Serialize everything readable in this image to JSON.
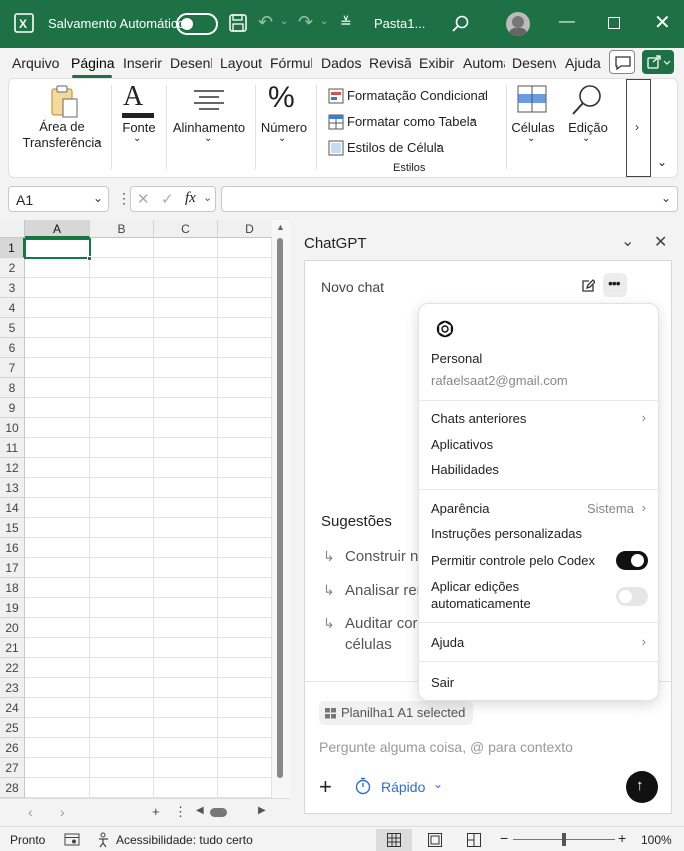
{
  "titlebar": {
    "autosave_label": "Salvamento Automático",
    "doc_name": "Pasta1..."
  },
  "menu_tabs": [
    "Arquivo",
    "Página",
    "Inserir",
    "Desenh",
    "Layout",
    "Fórmul",
    "Dados",
    "Revisã",
    "Exibir",
    "Automa",
    "Desenv",
    "Ajuda"
  ],
  "ribbon": {
    "clipboard": "Área de\nTransferência",
    "font": "Fonte",
    "alignment": "Alinhamento",
    "number": "Número",
    "cond_format": "Formatação Condicional",
    "format_table": "Formatar como Tabela",
    "cell_styles": "Estilos de Célula",
    "styles_group": "Estilos",
    "cells": "Células",
    "editing": "Edição",
    "clipboard_l1": "Área de",
    "clipboard_l2": "Transferência"
  },
  "formula": {
    "name_box": "A1",
    "fx": "fx"
  },
  "grid": {
    "columns": [
      "A",
      "B",
      "C",
      "D"
    ],
    "rows": [
      "1",
      "2",
      "3",
      "4",
      "5",
      "6",
      "7",
      "8",
      "9",
      "10",
      "11",
      "12",
      "13",
      "14",
      "15",
      "16",
      "17",
      "18",
      "19",
      "20",
      "21",
      "22",
      "23",
      "24",
      "25",
      "26",
      "27",
      "28"
    ]
  },
  "panel": {
    "title": "ChatGPT",
    "chat_title": "Novo chat",
    "suggestions_heading": "Sugestões",
    "suggestions": [
      "Construir n",
      "Analisar rer",
      "Auditar cor"
    ],
    "suggestion_cont": "células",
    "context_chip": "Planilha1 A1 selected",
    "input_placeholder": "Pergunte alguma coisa, @ para contexto",
    "mode": "Rápido"
  },
  "dropdown": {
    "plan": "Personal",
    "email": "rafaelsaat2@gmail.com",
    "previous_chats": "Chats anteriores",
    "apps": "Aplicativos",
    "skills": "Habilidades",
    "appearance": "Aparência",
    "appearance_value": "Sistema",
    "custom_instructions": "Instruções personalizadas",
    "codex_control": "Permitir controle pelo Codex",
    "auto_edit_l1": "Aplicar edições",
    "auto_edit_l2": "automaticamente",
    "help": "Ajuda",
    "logout": "Sair"
  },
  "status": {
    "ready": "Pronto",
    "accessibility": "Acessibilidade: tudo certo",
    "zoom": "100%"
  },
  "colors": {
    "excel_green": "#1e7145",
    "selection_green": "#107c41"
  }
}
